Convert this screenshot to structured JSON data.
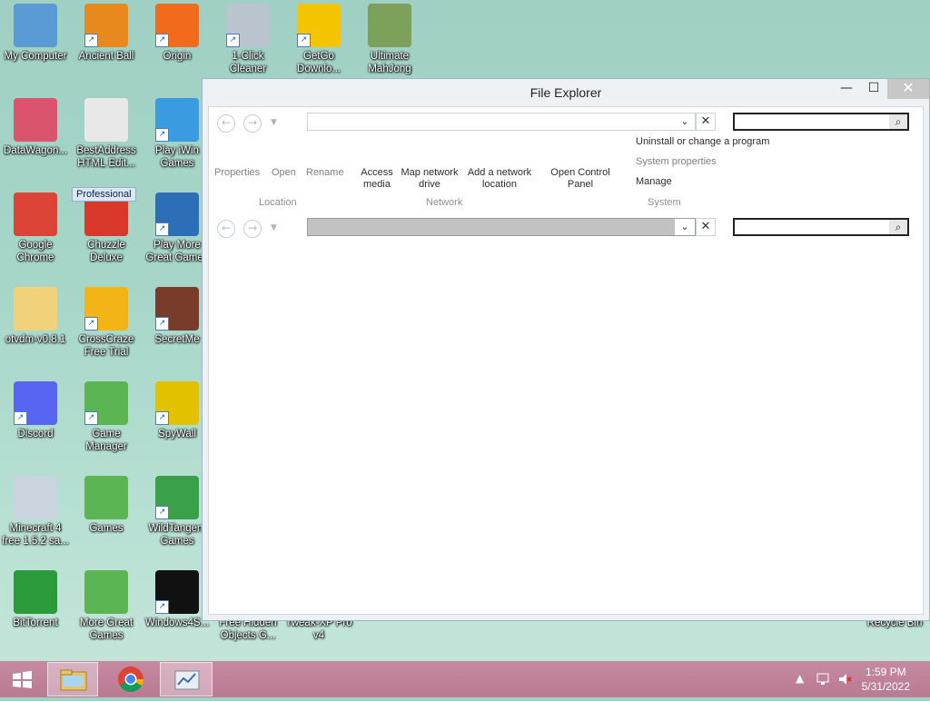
{
  "desktop": {
    "icons": [
      {
        "label": "My Computer"
      },
      {
        "label": "Ancient Ball"
      },
      {
        "label": "Origin"
      },
      {
        "label": "1-Click\nCleaner"
      },
      {
        "label": "GetGo\nDownlo..."
      },
      {
        "label": "Ultimate\nMahJong"
      },
      {
        "label": "DataWagon..."
      },
      {
        "label": "BestAddress\nHTML Edit..."
      },
      {
        "label": "Play iWin\nGames"
      },
      {
        "label": "Google\nChrome"
      },
      {
        "label": "Chuzzle\nDeluxe"
      },
      {
        "label": "Play More\nGreat Games"
      },
      {
        "label": "otvdm-v0.8.1"
      },
      {
        "label": "CrossCraze\nFree Trial"
      },
      {
        "label": "SecretMe"
      },
      {
        "label": "Discord"
      },
      {
        "label": "Game\nManager"
      },
      {
        "label": "SpyWall"
      },
      {
        "label": "Minecraft 4\nfree 1.5.2 sa..."
      },
      {
        "label": "Games"
      },
      {
        "label": "WildTangent\nGames"
      },
      {
        "label": "BitTorrent"
      },
      {
        "label": "More Great\nGames"
      },
      {
        "label": "Windows4S..."
      },
      {
        "label": "Free Hidden\nObjects G..."
      },
      {
        "label": "Tweak-XP Pro\nv4"
      },
      {
        "label": "Recycle Bin"
      }
    ],
    "tooltip": "Professional"
  },
  "window": {
    "title": "File Explorer",
    "controls": {
      "minimize": "—",
      "maximize": "☐",
      "close": "✕"
    },
    "ribbon": {
      "location_buttons": [
        "Properties",
        "Open",
        "Rename"
      ],
      "network_buttons": [
        "Access\nmedia",
        "Map network\ndrive",
        "Add a network\nlocation",
        "Open Control\nPanel"
      ],
      "system_buttons": [
        "Uninstall or change a program",
        "System properties",
        "Manage"
      ],
      "groups": {
        "location": "Location",
        "network": "Network",
        "system": "System"
      }
    },
    "nav": {
      "back": "←",
      "forward": "→",
      "dropdown": "▼",
      "clear": "✕",
      "chevron": "⌄",
      "search": "⌕"
    }
  },
  "taskbar": {
    "start_icon": "windows-logo-icon",
    "apps": [
      "file-explorer-icon",
      "chrome-icon",
      "tweak-app-icon"
    ],
    "clock": {
      "time": "1:59 PM",
      "date": "5/31/2022"
    },
    "tray": {
      "expand": "▲"
    }
  }
}
